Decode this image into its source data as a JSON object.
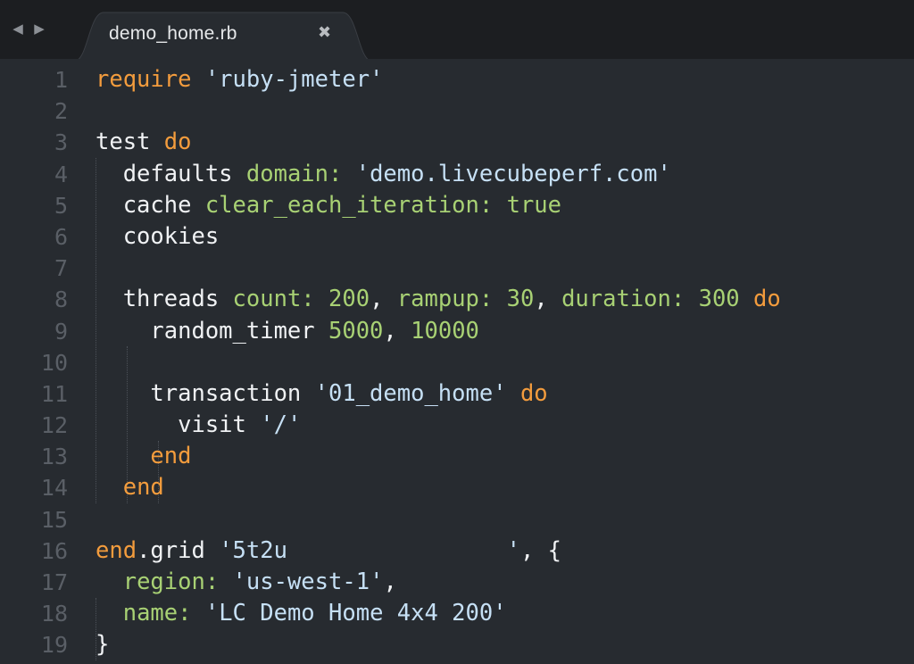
{
  "tab": {
    "back_arrow": "◀",
    "forward_arrow": "▶",
    "filename": "demo_home.rb",
    "close_glyph": "✖"
  },
  "colors": {
    "background": "#272b30",
    "keyword": "#f39c3d",
    "string": "#c6e0f5",
    "symbol": "#a8d174",
    "plain": "#f0f2f4",
    "line_number": "#5a5f66"
  },
  "editor": {
    "language": "ruby",
    "line_numbers": [
      "1",
      "2",
      "3",
      "4",
      "5",
      "6",
      "7",
      "8",
      "9",
      "10",
      "11",
      "12",
      "13",
      "14",
      "15",
      "16",
      "17",
      "18",
      "19"
    ],
    "lines": [
      [
        {
          "t": "kw",
          "v": "require"
        },
        {
          "t": "plain",
          "v": " "
        },
        {
          "t": "str",
          "v": "'ruby-jmeter'"
        }
      ],
      [],
      [
        {
          "t": "plain",
          "v": "test "
        },
        {
          "t": "kw",
          "v": "do"
        }
      ],
      [
        {
          "t": "plain",
          "v": "  defaults "
        },
        {
          "t": "sym",
          "v": "domain:"
        },
        {
          "t": "plain",
          "v": " "
        },
        {
          "t": "str",
          "v": "'demo.livecubeperf.com'"
        }
      ],
      [
        {
          "t": "plain",
          "v": "  cache "
        },
        {
          "t": "sym",
          "v": "clear_each_iteration:"
        },
        {
          "t": "plain",
          "v": " "
        },
        {
          "t": "num",
          "v": "true"
        }
      ],
      [
        {
          "t": "plain",
          "v": "  cookies"
        }
      ],
      [],
      [
        {
          "t": "plain",
          "v": "  threads "
        },
        {
          "t": "sym",
          "v": "count:"
        },
        {
          "t": "plain",
          "v": " "
        },
        {
          "t": "num",
          "v": "200"
        },
        {
          "t": "plain",
          "v": ", "
        },
        {
          "t": "sym",
          "v": "rampup:"
        },
        {
          "t": "plain",
          "v": " "
        },
        {
          "t": "num",
          "v": "30"
        },
        {
          "t": "plain",
          "v": ", "
        },
        {
          "t": "sym",
          "v": "duration:"
        },
        {
          "t": "plain",
          "v": " "
        },
        {
          "t": "num",
          "v": "300"
        },
        {
          "t": "plain",
          "v": " "
        },
        {
          "t": "kw",
          "v": "do"
        }
      ],
      [
        {
          "t": "plain",
          "v": "    random_timer "
        },
        {
          "t": "num",
          "v": "5000"
        },
        {
          "t": "plain",
          "v": ", "
        },
        {
          "t": "num",
          "v": "10000"
        }
      ],
      [],
      [
        {
          "t": "plain",
          "v": "    transaction "
        },
        {
          "t": "str",
          "v": "'01_demo_home'"
        },
        {
          "t": "plain",
          "v": " "
        },
        {
          "t": "kw",
          "v": "do"
        }
      ],
      [
        {
          "t": "plain",
          "v": "      visit "
        },
        {
          "t": "str",
          "v": "'/'"
        }
      ],
      [
        {
          "t": "plain",
          "v": "    "
        },
        {
          "t": "kw",
          "v": "end"
        }
      ],
      [
        {
          "t": "plain",
          "v": "  "
        },
        {
          "t": "kw",
          "v": "end"
        }
      ],
      [],
      [
        {
          "t": "kw",
          "v": "end"
        },
        {
          "t": "plain",
          "v": ".grid "
        },
        {
          "t": "str",
          "v": "'5t2u                '"
        },
        {
          "t": "plain",
          "v": ", {"
        }
      ],
      [
        {
          "t": "plain",
          "v": "  "
        },
        {
          "t": "sym",
          "v": "region:"
        },
        {
          "t": "plain",
          "v": " "
        },
        {
          "t": "str",
          "v": "'us-west-1'"
        },
        {
          "t": "plain",
          "v": ","
        }
      ],
      [
        {
          "t": "plain",
          "v": "  "
        },
        {
          "t": "sym",
          "v": "name:"
        },
        {
          "t": "plain",
          "v": " "
        },
        {
          "t": "str",
          "v": "'LC Demo Home 4x4 200'"
        }
      ],
      [
        {
          "t": "plain",
          "v": "}"
        }
      ]
    ]
  }
}
